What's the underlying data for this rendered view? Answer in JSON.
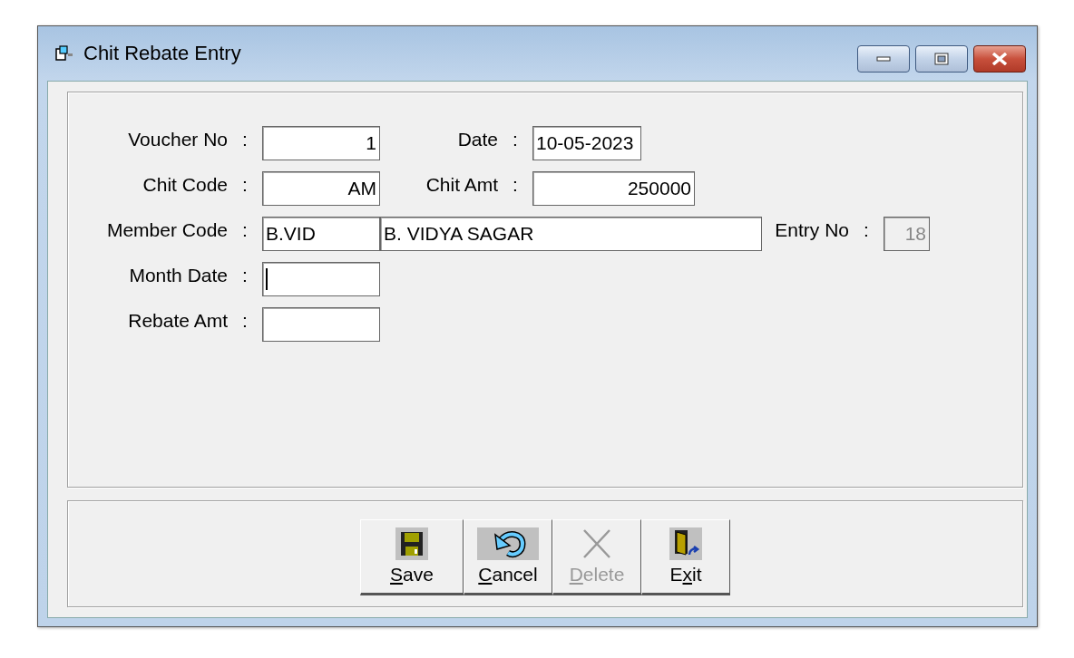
{
  "window": {
    "title": "Chit Rebate Entry"
  },
  "rows": [
    {
      "fields": [
        {
          "label": "Voucher No",
          "separator": ":",
          "value": "1",
          "kind": "numeric"
        },
        {
          "label": "Date",
          "separator": ":",
          "value": "10-05-2023",
          "kind": "date"
        }
      ]
    },
    {
      "fields": [
        {
          "label": "Chit Code",
          "separator": ":",
          "value": "AM",
          "kind": "numeric"
        },
        {
          "label": "Chit Amt",
          "separator": ":",
          "value": "250000",
          "kind": "numeric"
        }
      ]
    },
    {
      "fields": [
        {
          "label": "Member Code",
          "separator": ":",
          "value": "B.VID",
          "value2": "B. VIDYA SAGAR",
          "kind": "text"
        },
        {
          "label": "Entry No",
          "separator": ":",
          "value": "18",
          "kind": "numeric",
          "disabled": true
        }
      ]
    },
    {
      "fields": [
        {
          "label": "Month Date",
          "separator": ":",
          "kind": "text",
          "focused": true
        }
      ]
    },
    {
      "fields": [
        {
          "label": "Rebate Amt",
          "separator": ":",
          "kind": "text"
        }
      ]
    }
  ],
  "buttons": [
    {
      "kind": "save",
      "key": "S",
      "after": "ave",
      "disabled": false
    },
    {
      "kind": "cancel",
      "key": "C",
      "after": "ancel",
      "disabled": false
    },
    {
      "kind": "delete",
      "key": "D",
      "after": "elete",
      "disabled": true
    },
    {
      "kind": "exit",
      "before": "E",
      "key": "x",
      "after": "it",
      "disabled": false
    }
  ]
}
